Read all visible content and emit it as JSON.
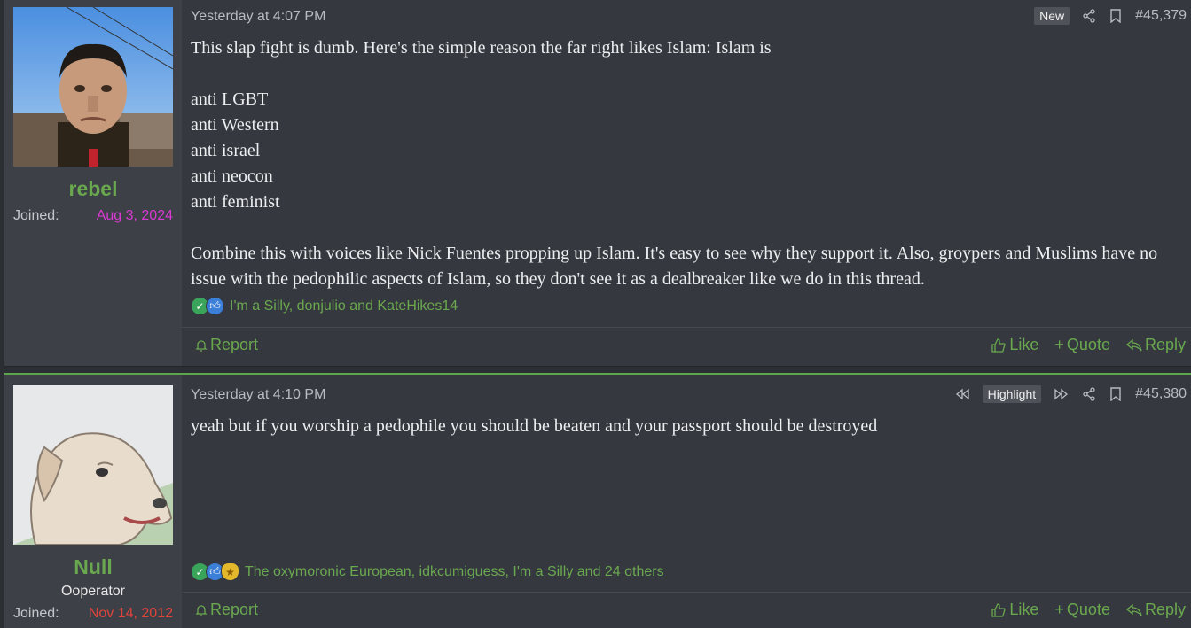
{
  "posts": [
    {
      "username": "rebel",
      "user_title": "",
      "joined_label": "Joined:",
      "joined_date": "Aug 3, 2024",
      "joined_color": "#d63ad0",
      "timestamp": "Yesterday at 4:07 PM",
      "badge": "New",
      "post_number": "#45,379",
      "body": [
        "This slap fight is dumb. Here's the simple reason the far right likes Islam: Islam is",
        "",
        "anti LGBT",
        "anti Western",
        "anti israel",
        "anti neocon",
        "anti feminist",
        "",
        "Combine this with voices like Nick Fuentes propping up Islam. It's easy to see why they support it. Also, groypers and Muslims have no issue with the pedophilic aspects of Islam, so they don't see it as a dealbreaker like we do in this thread."
      ],
      "reactions": "I'm a Silly, donjulio and KateHikes14",
      "reaction_icons": [
        "check-icon",
        "thumbs-up-icon"
      ],
      "report_label": "Report",
      "like_label": "Like",
      "quote_label": "Quote",
      "reply_label": "Reply"
    },
    {
      "username": "Null",
      "user_title": "Ooperator",
      "joined_label": "Joined:",
      "joined_date": "Nov 14, 2012",
      "joined_color": "#e0443a",
      "timestamp": "Yesterday at 4:10 PM",
      "badge": "Highlight",
      "post_number": "#45,380",
      "body": [
        "yeah but if you worship a pedophile you should be beaten and your passport should be destroyed"
      ],
      "reactions": "The oxymoronic European, idkcumiguess, I'm a Silly and 24 others",
      "reaction_icons": [
        "check-icon",
        "thumbs-up-icon",
        "medal-icon"
      ],
      "report_label": "Report",
      "like_label": "Like",
      "quote_label": "Quote",
      "reply_label": "Reply"
    }
  ],
  "colors": {
    "accent": "#6aa84f",
    "post_bg": "#35383e",
    "sidebar_bg": "#3d4046"
  }
}
